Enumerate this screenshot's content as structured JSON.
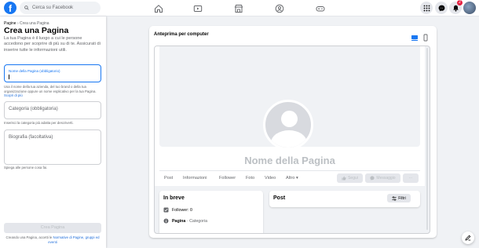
{
  "topbar": {
    "logo_letter": "f",
    "search_placeholder": "Cerca su Facebook",
    "nav_icons": [
      "home-icon",
      "watch-icon",
      "marketplace-icon",
      "groups-icon",
      "gaming-icon"
    ],
    "right_icons": [
      "menu-grid-icon",
      "messenger-icon",
      "bell-icon"
    ],
    "notification_count": "2",
    "accent_color": "#1877f2"
  },
  "sidebar": {
    "breadcrumb_root": "Pagine",
    "breadcrumb_sep": " › ",
    "breadcrumb_current": "Crea una Pagina",
    "title": "Crea una Pagina",
    "intro": "La tua Pagina è il luogo a cui le persone accedono per scoprire di più su di te. Assicurati di inserire tutte le informazioni utili.",
    "name_label": "Nome della Pagina (obbligatorio)",
    "name_value": "",
    "name_help": "Usa il nome della tua azienda, del tuo brand o della tua organizzazione oppure un nome esplicativo per la tua Pagina.",
    "name_help_link": "Scopri di più",
    "category_placeholder": "Categoria (obbligatoria)",
    "category_help": "Inserisci la categoria più adatta per descriverti.",
    "bio_placeholder": "Biografia (facoltativa)",
    "bio_help": "Spiega alle persone cosa fai.",
    "create_button": "Crea Pagina",
    "terms_text": "Creando una Pagina, accetti le",
    "terms_link": "Normative di Pagine, gruppi ed eventi"
  },
  "preview": {
    "title": "Anteprima per computer",
    "device_icons": [
      "desktop-icon",
      "mobile-icon"
    ],
    "page_name": "Nome della Pagina",
    "tabs": [
      "Post",
      "Informazioni",
      "Follower",
      "Foto",
      "Video",
      "Altro ▾"
    ],
    "follow_button": "Segui",
    "message_button": "Messaggio",
    "more_button": "···",
    "intro_card": {
      "title": "In breve",
      "followers": "Follower: 0",
      "page_label": "Pagina",
      "page_category": " · Categoria"
    },
    "posts_card": {
      "title": "Post",
      "filter_button": "Filtri"
    }
  }
}
